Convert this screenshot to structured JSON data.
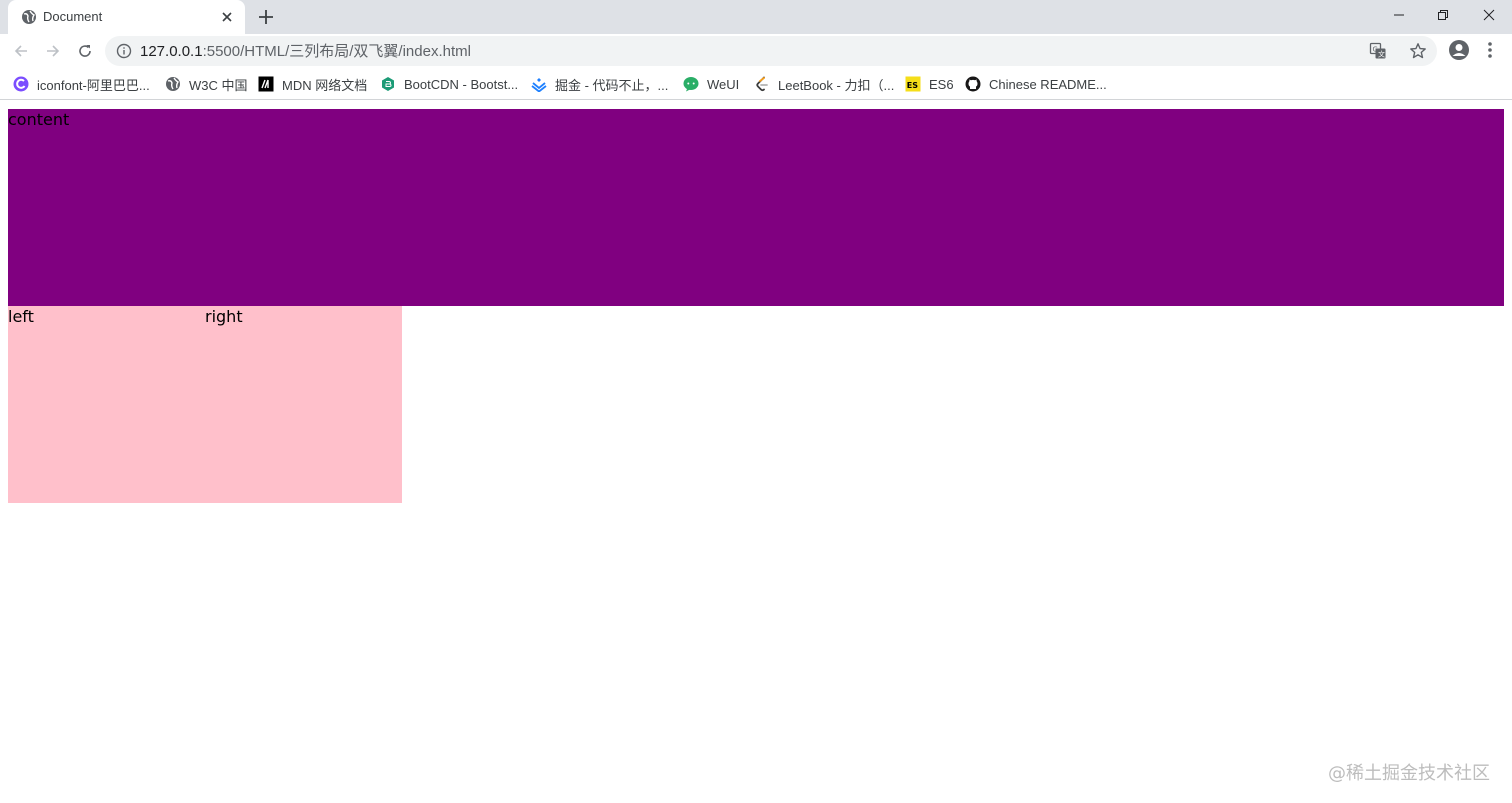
{
  "browser": {
    "tab": {
      "title": "Document",
      "favicon": "globe-icon"
    },
    "address": {
      "host": "127.0.0.1",
      "path": ":5500/HTML/三列布局/双飞翼/index.html"
    },
    "bookmarks": [
      {
        "label": "iconfont-阿里巴巴...",
        "icon": "iconfont-icon",
        "color": "#7b4dff"
      },
      {
        "label": "W3C 中国",
        "icon": "globe-icon",
        "color": "#5f6368"
      },
      {
        "label": "MDN 网络文档",
        "icon": "mdn-icon",
        "color": "#000000"
      },
      {
        "label": "BootCDN - Bootst...",
        "icon": "bootcdn-icon",
        "color": "#1b9b76"
      },
      {
        "label": "掘金 - 代码不止，...",
        "icon": "juejin-icon",
        "color": "#1e80ff"
      },
      {
        "label": "WeUI",
        "icon": "weui-icon",
        "color": "#2aae67"
      },
      {
        "label": "LeetBook - 力扣（...",
        "icon": "leetcode-icon",
        "color": "#f89f1b"
      },
      {
        "label": "ES6",
        "icon": "es6-icon",
        "color": "#f5de19"
      },
      {
        "label": "Chinese README...",
        "icon": "github-icon",
        "color": "#181717"
      }
    ]
  },
  "page": {
    "content_label": "content",
    "left_label": "left",
    "right_label": "right",
    "colors": {
      "content": "#800080",
      "side": "#ffc0cb"
    },
    "watermark": "@稀土掘金技术社区"
  }
}
